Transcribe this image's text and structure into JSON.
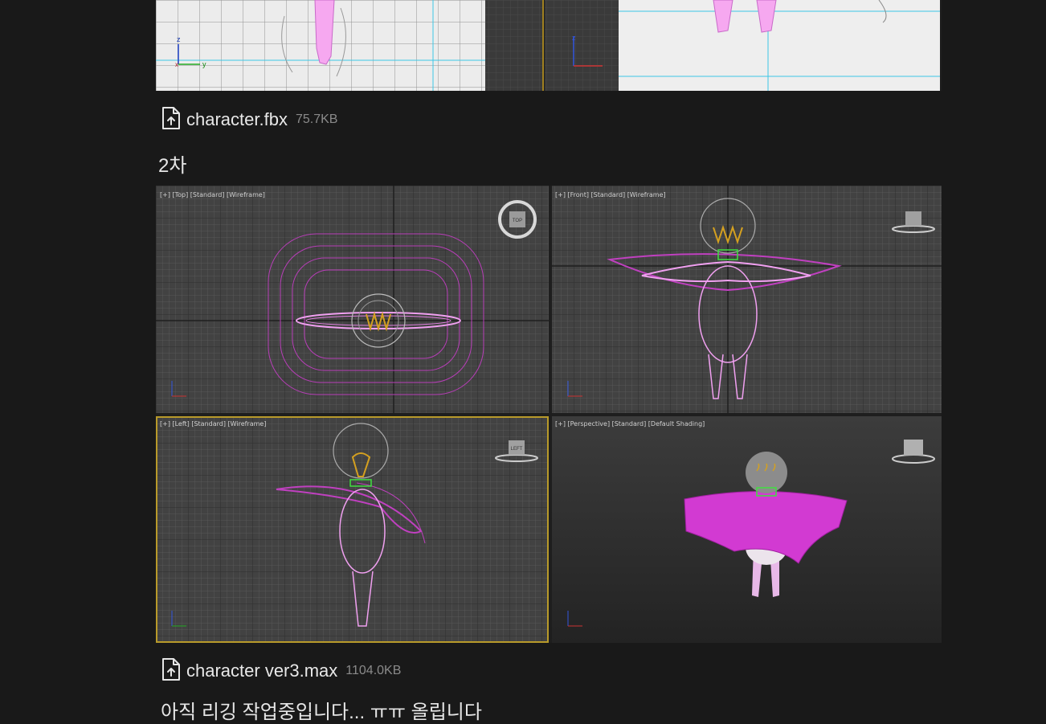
{
  "attachments": [
    {
      "name": "character.fbx",
      "size": "75.7KB",
      "icon": "file-upload-icon"
    },
    {
      "name": "character ver3.max",
      "size": "1104.0KB",
      "icon": "file-upload-icon"
    }
  ],
  "section_heading": "2차",
  "screenshot": {
    "viewports": {
      "top": "[+] [Top] [Standard] [Wireframe]",
      "front": "[+] [Front] [Standard] [Wireframe]",
      "left": "[+] [Left] [Standard] [Wireframe]",
      "perspective": "[+] [Perspective] [Standard] [Default Shading]"
    },
    "viewcube": {
      "top": "TOP",
      "left": "LEFT"
    }
  },
  "footer_partial_text": "아직 리깅 작업중입니다... ㅠㅠ 올립니다"
}
